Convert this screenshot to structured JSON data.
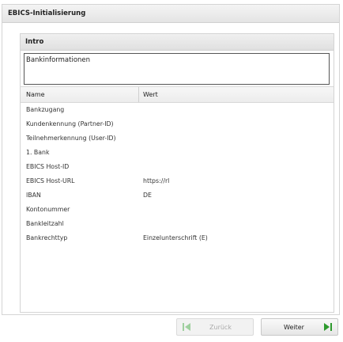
{
  "dialog": {
    "title": "EBICS-Initialisierung"
  },
  "panel": {
    "title": "Intro"
  },
  "intro": {
    "text": "Bankinformationen"
  },
  "table": {
    "headers": {
      "name": "Name",
      "value": "Wert"
    },
    "rows": [
      {
        "name": "Bankzugang",
        "value": ""
      },
      {
        "name": "Kundenkennung (Partner-ID)",
        "value": ""
      },
      {
        "name": "Teilnehmerkennung (User-ID)",
        "value": ""
      },
      {
        "name": "1. Bank",
        "value": ""
      },
      {
        "name": "EBICS Host-ID",
        "value": ""
      },
      {
        "name": "EBICS Host-URL",
        "value": "https://rl"
      },
      {
        "name": "IBAN",
        "value": "DE"
      },
      {
        "name": "Kontonummer",
        "value": ""
      },
      {
        "name": "Bankleitzahl",
        "value": ""
      },
      {
        "name": "Bankrechttyp",
        "value": "Einzelunterschrift (E)"
      }
    ]
  },
  "buttons": {
    "back": "Zurück",
    "next": "Weiter"
  },
  "colors": {
    "nav_icon": "#2e9a2e",
    "nav_icon_disabled": "#9fd09f"
  }
}
